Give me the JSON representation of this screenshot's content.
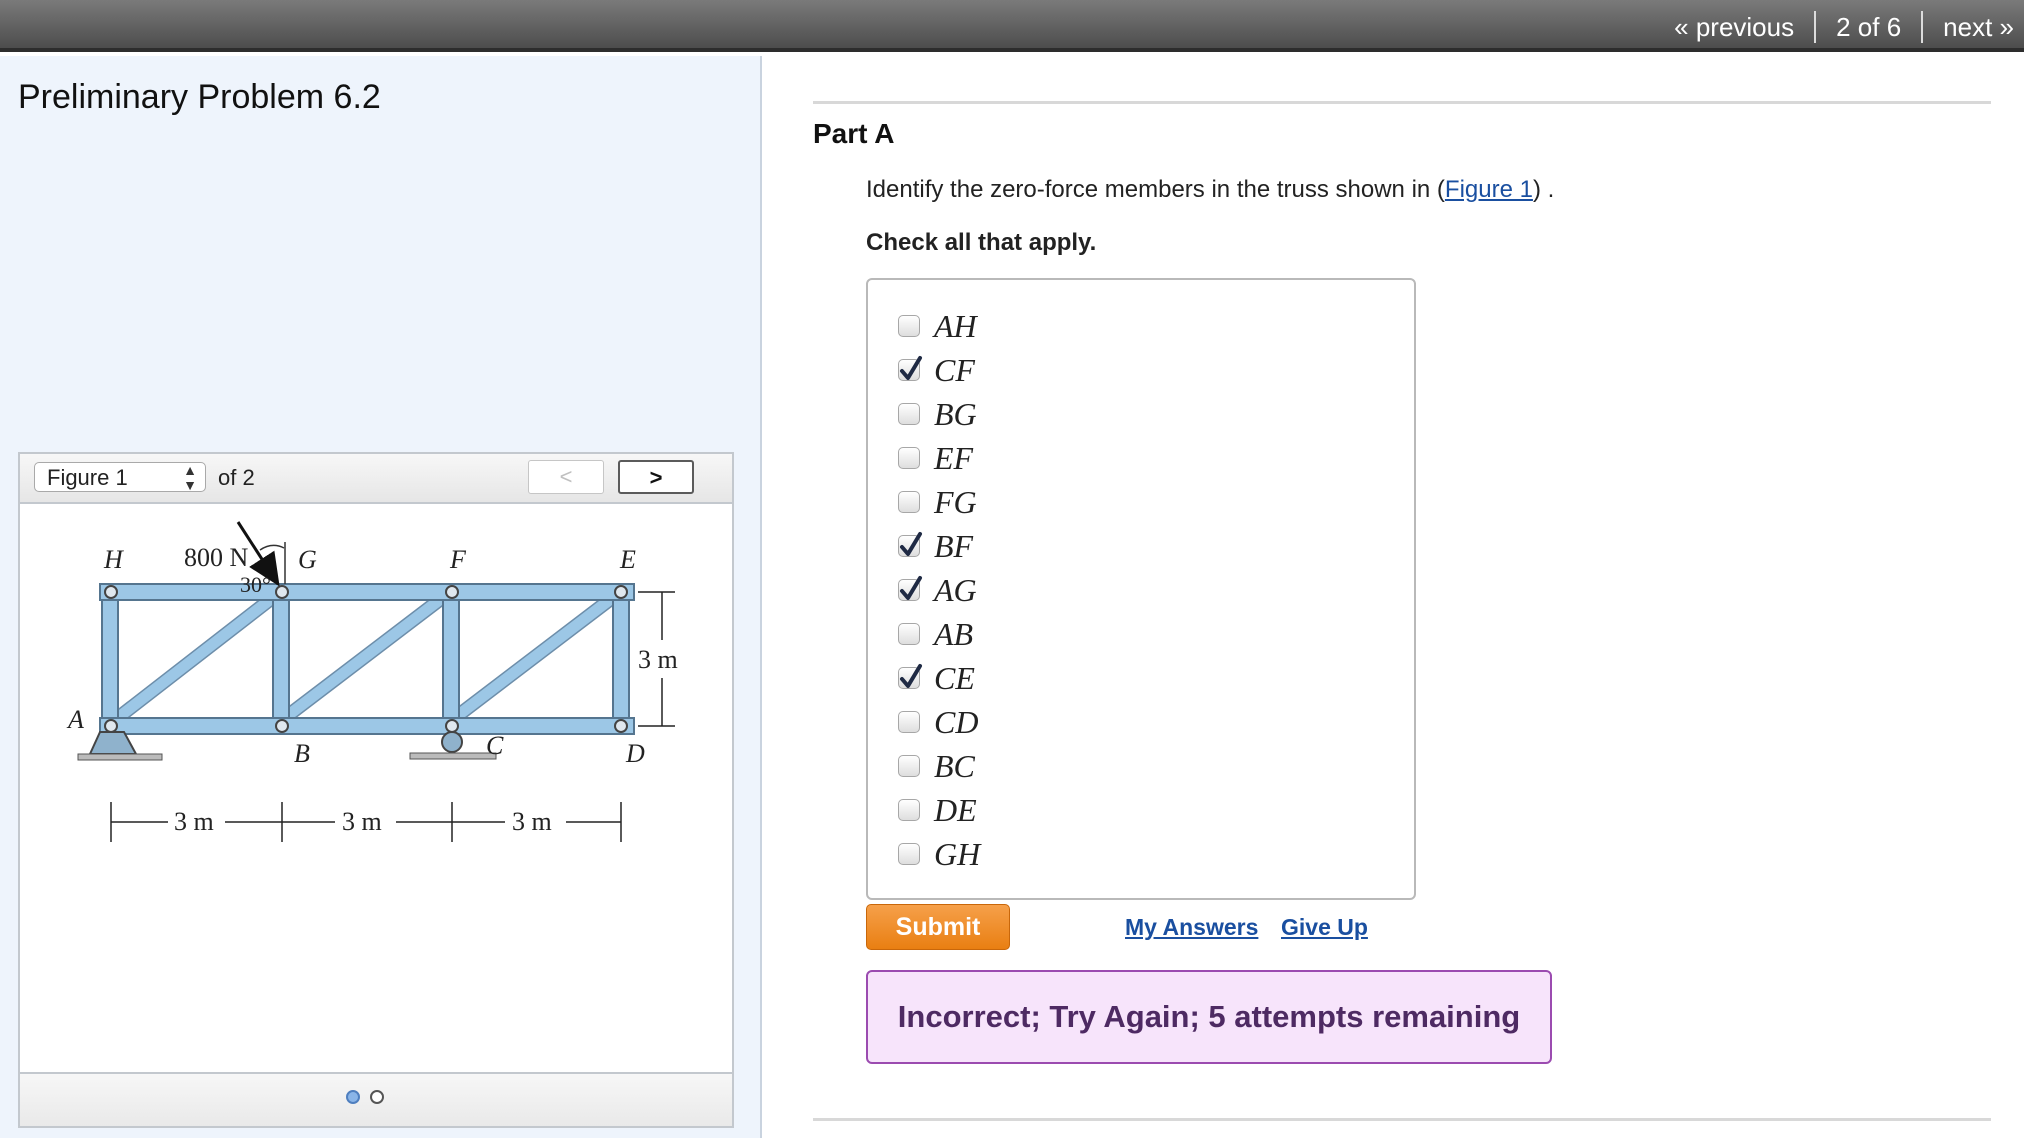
{
  "navigation": {
    "previous_label": "« previous",
    "position_label": "2 of 6",
    "next_label": "next »"
  },
  "problem": {
    "title": "Preliminary Problem 6.2"
  },
  "figure_viewer": {
    "selected": "Figure 1",
    "of_label": "of 2",
    "prev_icon": "chevron-left-icon",
    "next_icon": "chevron-right-icon",
    "page_dots": {
      "count": 2,
      "active_index": 0
    },
    "figure": {
      "force_label": "800 N",
      "angle_label": "30°",
      "joints": {
        "H": "H",
        "G": "G",
        "F": "F",
        "E": "E",
        "A": "A",
        "B": "B",
        "C": "C",
        "D": "D"
      },
      "dimensions": {
        "span1": "3 m",
        "span2": "3 m",
        "span3": "3 m",
        "height": "3 m"
      }
    }
  },
  "part": {
    "title": "Part A",
    "question_prefix": "Identify the zero-force members in the truss shown in (",
    "figure_link": "Figure 1",
    "question_suffix": ") .",
    "instruction": "Check all that apply."
  },
  "options": [
    {
      "label": "AH",
      "checked": false
    },
    {
      "label": "CF",
      "checked": true
    },
    {
      "label": "BG",
      "checked": false
    },
    {
      "label": "EF",
      "checked": false
    },
    {
      "label": "FG",
      "checked": false
    },
    {
      "label": "BF",
      "checked": true
    },
    {
      "label": "AG",
      "checked": true
    },
    {
      "label": "AB",
      "checked": false
    },
    {
      "label": "CE",
      "checked": true
    },
    {
      "label": "CD",
      "checked": false
    },
    {
      "label": "BC",
      "checked": false
    },
    {
      "label": "DE",
      "checked": false
    },
    {
      "label": "GH",
      "checked": false
    }
  ],
  "actions": {
    "submit_label": "Submit",
    "my_answers_label": "My Answers",
    "give_up_label": "Give Up"
  },
  "feedback": {
    "message": "Incorrect; Try Again; 5 attempts remaining"
  },
  "colors": {
    "accent_orange": "#ef8a1f",
    "feedback_border": "#9b4bb0",
    "link_blue": "#1a4fa0",
    "truss_member": "#9cc7e6"
  }
}
